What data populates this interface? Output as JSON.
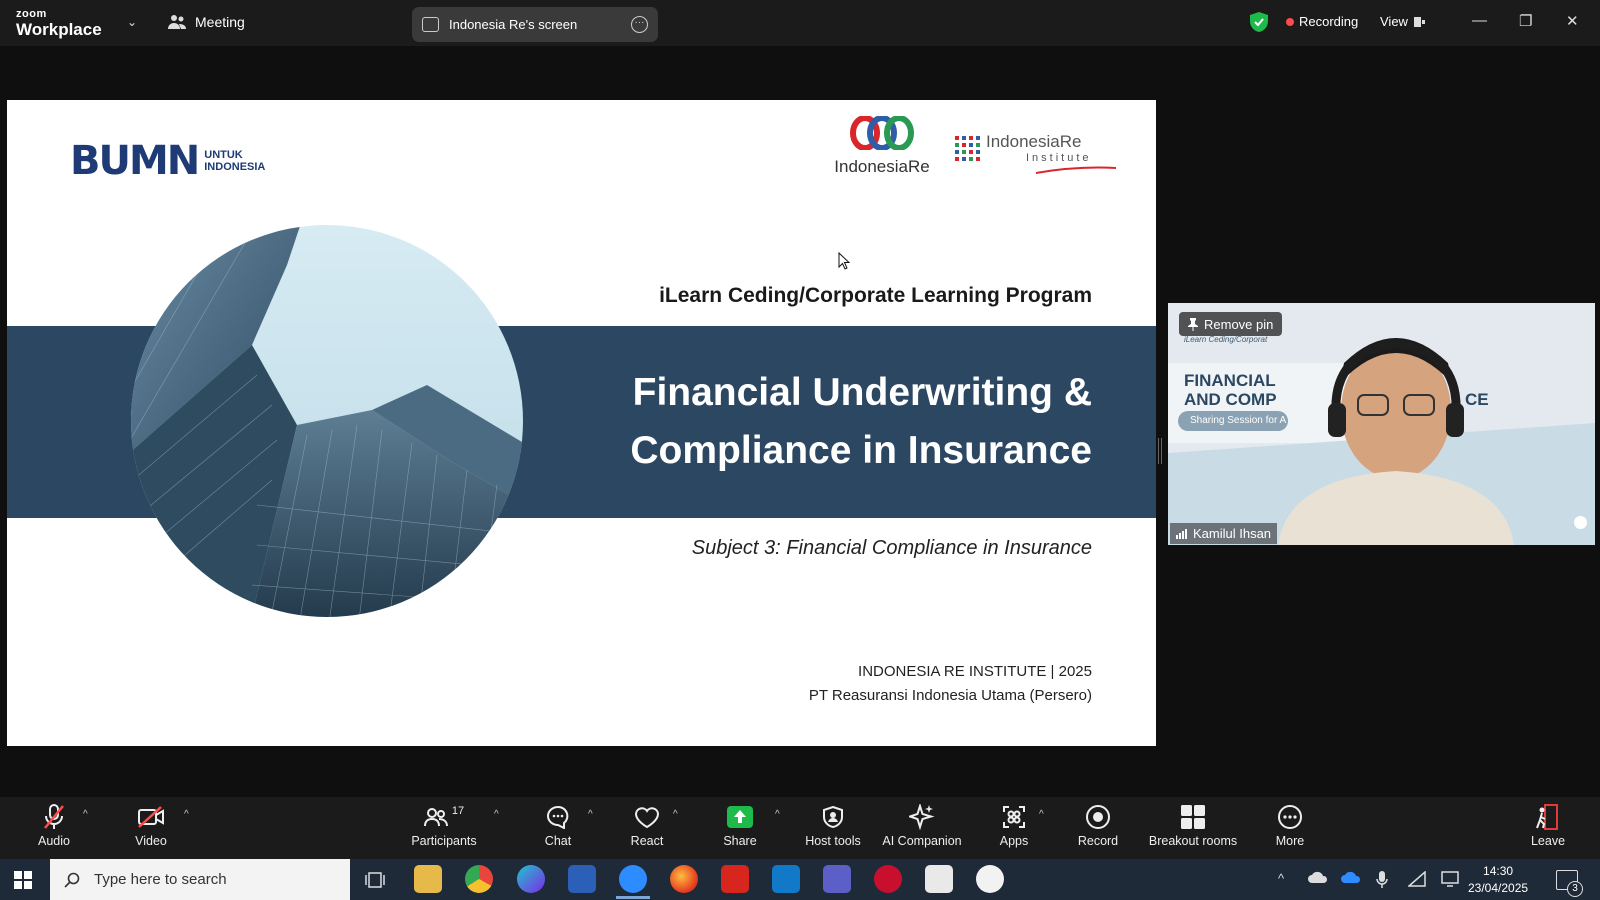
{
  "app": {
    "brand_small": "zoom",
    "brand_large": "Workplace",
    "meeting_label": "Meeting",
    "share_pill": "Indonesia Re's screen",
    "recording_label": "Recording",
    "view_label": "View"
  },
  "slide": {
    "logo_left_big": "BUMN",
    "logo_left_small_1": "UNTUK",
    "logo_left_small_2": "INDONESIA",
    "logo_center": "IndonesiaRe",
    "logo_right": "IndonesiaRe",
    "logo_right_sub": "Institute",
    "program": "iLearn Ceding/Corporate Learning Program",
    "title_line1": "Financial Underwriting &",
    "title_line2": "Compliance in Insurance",
    "subject": "Subject 3: Financial Compliance in Insurance",
    "footer_line1": "INDONESIA RE INSTITUTE | 2025",
    "footer_line2": "PT Reasuransi Indonesia Utama (Persero)"
  },
  "video": {
    "pin_label": "Remove pin",
    "participant_name": "Kamilul Ihsan",
    "background_text_1": "iLearn Ceding/Corporat",
    "background_text_2": "FINANCIAL",
    "background_text_3": "AND COMP",
    "background_text_4": "CE",
    "background_text_5": "Sharing Session for A"
  },
  "toolbar": {
    "audio": "Audio",
    "video": "Video",
    "participants": "Participants",
    "participants_count": "17",
    "chat": "Chat",
    "react": "React",
    "share": "Share",
    "host_tools": "Host tools",
    "ai_companion": "AI Companion",
    "apps": "Apps",
    "record": "Record",
    "breakout": "Breakout rooms",
    "more": "More",
    "leave": "Leave"
  },
  "taskbar": {
    "search_placeholder": "Type here to search",
    "time": "14:30",
    "date": "23/04/2025",
    "notification_count": "3"
  },
  "colors": {
    "slide_band": "#2c4762",
    "share_green": "#1fbb4a",
    "recording_red": "#ff4b4b",
    "leave_red": "#e03a3a"
  }
}
